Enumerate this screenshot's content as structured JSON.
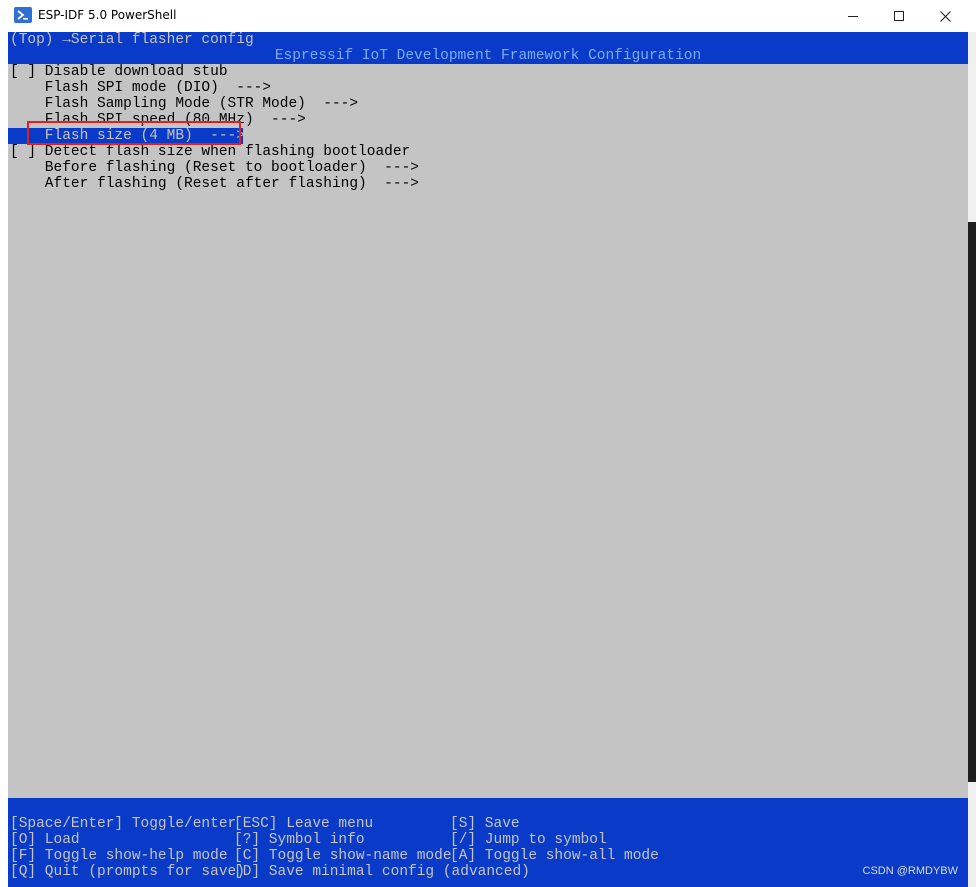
{
  "window": {
    "title": "ESP-IDF 5.0 PowerShell",
    "icon": "powershell-icon",
    "controls": {
      "minimize": "minimize-icon",
      "maximize": "maximize-icon",
      "close": "close-icon"
    }
  },
  "terminal": {
    "breadcrumb": "(Top) →Serial flasher config",
    "header": "Espressif IoT Development Framework Configuration",
    "menu": [
      {
        "text": "[ ] Disable download stub"
      },
      {
        "text": "    Flash SPI mode (DIO)  --->"
      },
      {
        "text": "    Flash Sampling Mode (STR Mode)  --->"
      },
      {
        "text": "    Flash SPI speed (80 MHz)  --->"
      },
      {
        "text": "    Flash size (4 MB)  --->",
        "selected": true
      },
      {
        "text": "[ ] Detect flash size when flashing bootloader"
      },
      {
        "text": "    Before flashing (Reset to bootloader)  --->"
      },
      {
        "text": "    After flashing (Reset after flashing)  --->"
      }
    ],
    "help": [
      [
        "[Space/Enter] Toggle/enter",
        "[ESC] Leave menu",
        "[S] Save"
      ],
      [
        "[O] Load",
        "[?] Symbol info",
        "[/] Jump to symbol"
      ],
      [
        "[F] Toggle show-help mode",
        "[C] Toggle show-name mode",
        "[A] Toggle show-all mode"
      ],
      [
        "[Q] Quit (prompts for save)",
        "[D] Save minimal config (advanced)",
        ""
      ]
    ]
  },
  "watermark": "CSDN @RMDYBW",
  "colors": {
    "terminal_bg": "#c4c4c4",
    "bar_blue": "#0a3bc8",
    "highlight_red": "#e02020"
  }
}
